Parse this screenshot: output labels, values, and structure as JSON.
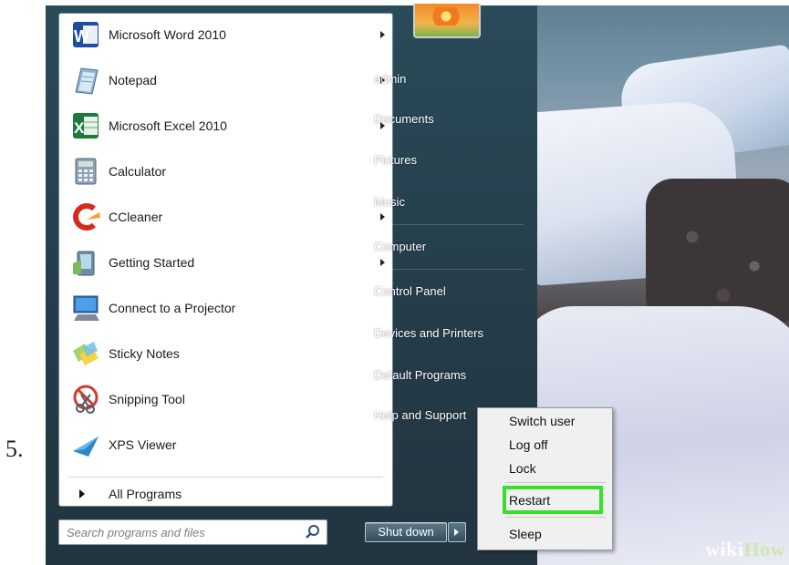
{
  "step_number": "5.",
  "start_menu": {
    "programs": [
      {
        "label": "Microsoft Word 2010",
        "icon": "word-icon",
        "has_submenu": true
      },
      {
        "label": "Notepad",
        "icon": "notepad-icon",
        "has_submenu": true
      },
      {
        "label": "Microsoft Excel 2010",
        "icon": "excel-icon",
        "has_submenu": true
      },
      {
        "label": "Calculator",
        "icon": "calculator-icon",
        "has_submenu": false
      },
      {
        "label": "CCleaner",
        "icon": "ccleaner-icon",
        "has_submenu": true
      },
      {
        "label": "Getting Started",
        "icon": "getting-started-icon",
        "has_submenu": true
      },
      {
        "label": "Connect to a Projector",
        "icon": "projector-icon",
        "has_submenu": false
      },
      {
        "label": "Sticky Notes",
        "icon": "sticky-notes-icon",
        "has_submenu": false
      },
      {
        "label": "Snipping Tool",
        "icon": "snipping-tool-icon",
        "has_submenu": false
      },
      {
        "label": "XPS Viewer",
        "icon": "xps-viewer-icon",
        "has_submenu": false
      }
    ],
    "all_programs_label": "All Programs",
    "search": {
      "placeholder": "Search programs and files"
    },
    "right_pane": [
      "admin",
      "Documents",
      "Pictures",
      "Music",
      "Computer",
      "Control Panel",
      "Devices and Printers",
      "Default Programs",
      "Help and Support"
    ],
    "shutdown_label": "Shut down"
  },
  "power_menu": {
    "items": [
      "Switch user",
      "Log off",
      "Lock",
      "Restart",
      "Sleep"
    ],
    "highlighted": "Restart",
    "highlight_color": "#39e02a"
  },
  "watermark": {
    "part1": "wiki",
    "part2": "How"
  }
}
